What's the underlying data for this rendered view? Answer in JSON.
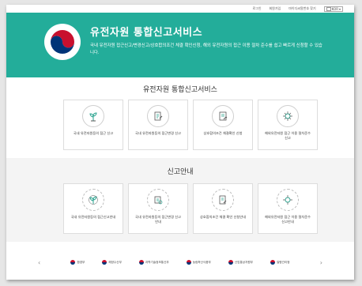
{
  "topbar": {
    "login": "로그인",
    "signup": "회원가입",
    "mypage": "마이디씨알번호 찾기",
    "lang": "KOR"
  },
  "hero": {
    "title": "유전자원 통합신고서비스",
    "description": "국내 유전자원 접근신고/변경신고/상호합의조건 체결 확인신청, 해외 유전자원의 접근 이용 절차 준수를 쉽고 빠르게 신청할 수 있습니다."
  },
  "services": {
    "title": "유전자원 통합신고서비스",
    "items": [
      {
        "label": "국내 유전자원등의 접근 신고",
        "icon": "plant-icon"
      },
      {
        "label": "국내 유전자원등의 접근변경 신고",
        "icon": "document-edit-icon"
      },
      {
        "label": "상호합의조건 체결확인 신청",
        "icon": "handshake-document-icon"
      },
      {
        "label": "해외유전자원 접근 이용 절차준수 신고",
        "icon": "virus-icon"
      }
    ]
  },
  "guide": {
    "title": "신고안내",
    "items": [
      {
        "label": "국내 유전자원등의 접근신고안내",
        "icon": "plant-guide-icon"
      },
      {
        "label": "국내 유전자원등의 접근변경 신고안내",
        "icon": "document-guide-icon"
      },
      {
        "label": "상호합의조건 체결 확인 신청안내",
        "icon": "handshake-guide-icon"
      },
      {
        "label": "해외유전자원 접근 이용 절차준수 신고안내",
        "icon": "virus-guide-icon"
      }
    ]
  },
  "footer": {
    "partners": [
      "환경부",
      "해양수산부",
      "과학기술정보통신부",
      "농림축산식품부",
      "산업통상자원부",
      "질병관리청"
    ]
  }
}
